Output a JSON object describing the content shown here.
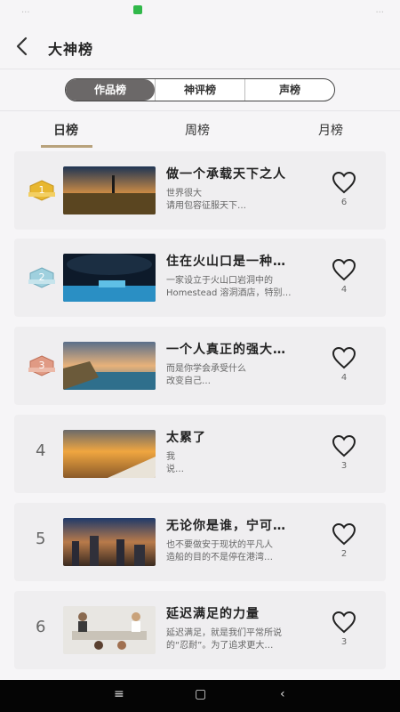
{
  "status": {
    "left": "...",
    "right": "..."
  },
  "header": {
    "title": "大神榜"
  },
  "segments": [
    {
      "label": "作品榜",
      "active": true
    },
    {
      "label": "神评榜",
      "active": false
    },
    {
      "label": "声榜",
      "active": false
    }
  ],
  "tabs": [
    {
      "label": "日榜",
      "active": true
    },
    {
      "label": "周榜",
      "active": false
    },
    {
      "label": "月榜",
      "active": false
    }
  ],
  "items": [
    {
      "rank": "1",
      "title": "做一个承载天下之人",
      "desc1": "世界很大",
      "desc2": "请用包容征服天下…",
      "likes": "6",
      "badge_color": "#e8b730"
    },
    {
      "rank": "2",
      "title": "住在火山口是一种…",
      "desc1": "一家设立于火山口岩洞中的",
      "desc2": "Homestead 溶洞酒店，特别…",
      "likes": "4",
      "badge_color": "#8fc6d6"
    },
    {
      "rank": "3",
      "title": "一个人真正的强大…",
      "desc1": "而是你学会承受什么",
      "desc2": "改变自己…",
      "likes": "4",
      "badge_color": "#d98a74"
    },
    {
      "rank": "4",
      "title": "太累了",
      "desc1": "我",
      "desc2": "说…",
      "likes": "3"
    },
    {
      "rank": "5",
      "title": "无论你是谁，宁可…",
      "desc1": "也不要做安于现状的平凡人",
      "desc2": "造船的目的不是停在港湾…",
      "likes": "2"
    },
    {
      "rank": "6",
      "title": "延迟满足的力量",
      "desc1": "延迟满足，就是我们平常所说",
      "desc2": "的“忍耐”。为了追求更大…",
      "likes": "3"
    }
  ],
  "navbar": {
    "menu": "≡",
    "home": "▢",
    "back": "‹"
  }
}
